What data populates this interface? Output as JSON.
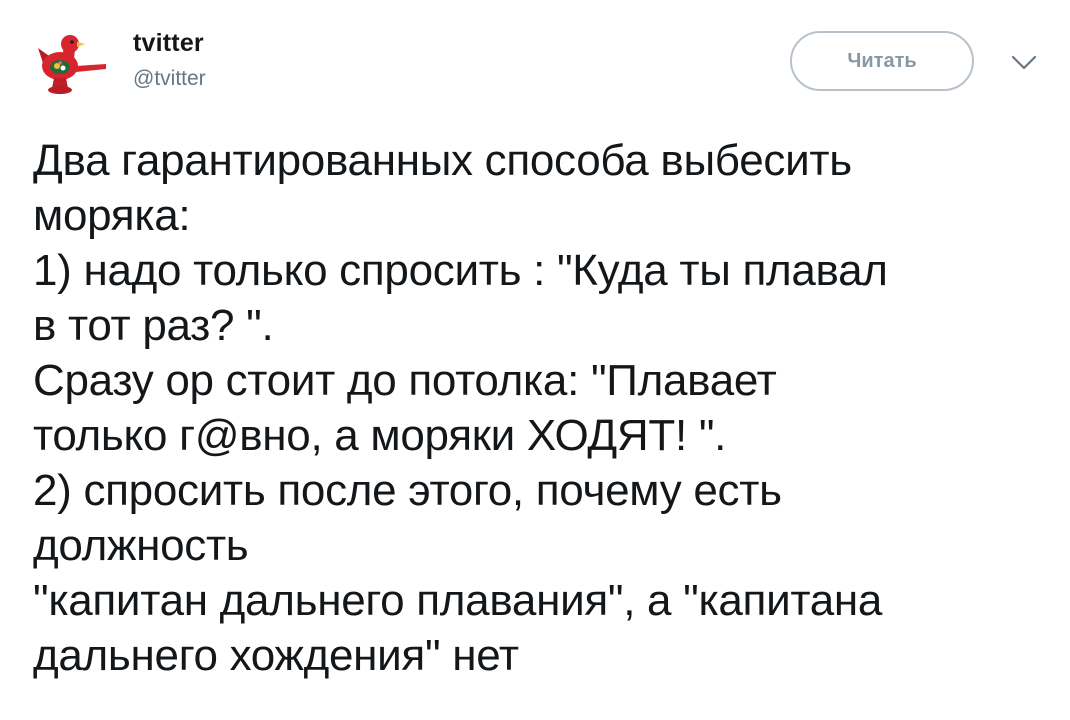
{
  "header": {
    "display_name": "tvitter",
    "handle": "@tvitter",
    "follow_label": "Читать",
    "avatar_icon": "red-bird-whistle-icon",
    "menu_icon": "chevron-down-icon"
  },
  "tweet": {
    "text": "Два гарантированных способа выбесить\nморяка:\n1) надо только спросить : \"Куда ты плавал\nв тот раз? \".\nСразу ор стоит до потолка: \"Плавает\nтолько г@вно, а моряки ХОДЯТ! \".\n2) спросить после этого, почему есть\nдолжность\n\"капитан дальнего плавания\", а \"капитана\nдальнего хождения\" нет"
  },
  "colors": {
    "text": "#14171a",
    "secondary": "#657786",
    "button_border": "#b8c2cb",
    "button_text": "#8899a6",
    "bird_red": "#d8252d"
  }
}
